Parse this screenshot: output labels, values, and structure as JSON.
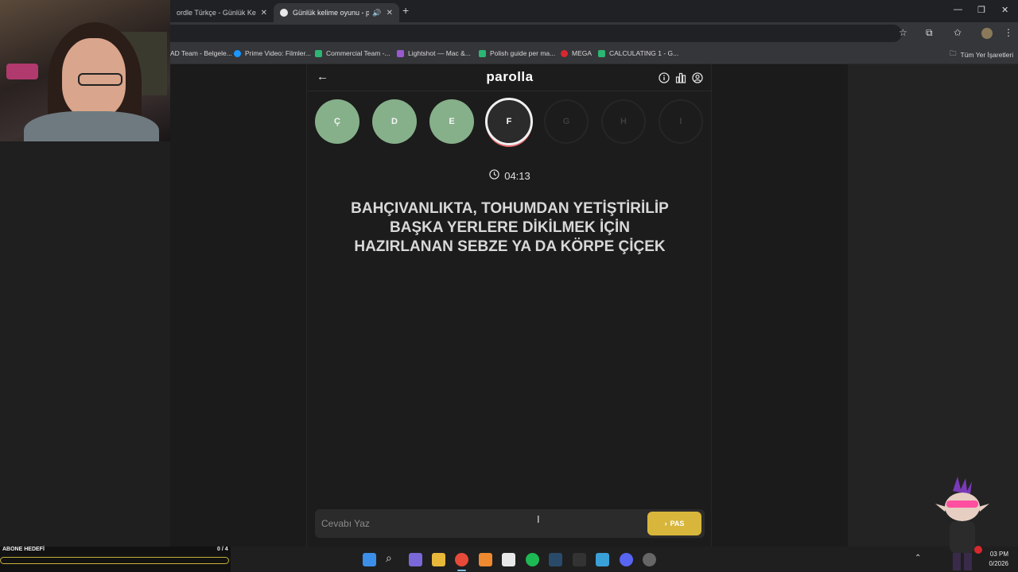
{
  "browser": {
    "tabs": [
      {
        "title": "ordle Türkçe - Günlük Kelime",
        "active": false
      },
      {
        "title": "Günlük kelime oyunu - par",
        "active": true
      }
    ],
    "bookmarks": [
      {
        "label": "AD Team - Belgele...",
        "color": "#6b8cff"
      },
      {
        "label": "Prime Video: Filmler...",
        "color": "#1a98ff"
      },
      {
        "label": "Commercial Team -...",
        "color": "#2bb673"
      },
      {
        "label": "Lightshot — Mac &...",
        "color": "#9b59d0"
      },
      {
        "label": "Polish guide per ma...",
        "color": "#2bb673"
      },
      {
        "label": "MEGA",
        "color": "#d9272e"
      },
      {
        "label": "CALCULATING 1 - G...",
        "color": "#2bb673"
      }
    ],
    "all_bookmarks": "Tüm Yer İşaretleri"
  },
  "app": {
    "brand": "parolla",
    "letters": [
      {
        "char": "Ç",
        "state": "done"
      },
      {
        "char": "D",
        "state": "done"
      },
      {
        "char": "E",
        "state": "done"
      },
      {
        "char": "F",
        "state": "active"
      },
      {
        "char": "G",
        "state": "todo"
      },
      {
        "char": "H",
        "state": "todo"
      },
      {
        "char": "I",
        "state": "todo"
      }
    ],
    "timer": "04:13",
    "question": "BAHÇIVANLIKTA, TOHUMDAN YETİŞTİRİLİP BAŞKA YERLERE DİKİLMEK İÇİN HAZIRLANAN SEBZE YA DA KÖRPE ÇİÇEK",
    "answer_placeholder": "Cevabı Yaz",
    "pass_label": "PAS"
  },
  "stream": {
    "goal_label": "ABONE HEDEFİ",
    "goal_count": "0 / 4",
    "goal_progress": 0
  },
  "taskbar": {
    "time": "03 PM",
    "date": "0/2026"
  }
}
